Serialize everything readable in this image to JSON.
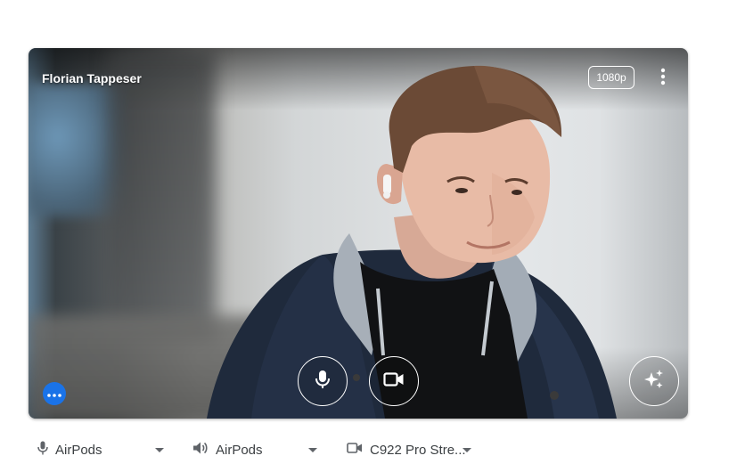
{
  "preview": {
    "participant_name": "Florian Tappeser",
    "resolution_badge": "1080p"
  },
  "controls": {
    "mic_icon": "mic-icon",
    "camera_icon": "videocam-icon",
    "effects_icon": "sparkles-icon",
    "more_icon": "more-vert-icon",
    "overflow_icon": "more-horiz-icon"
  },
  "devices": {
    "microphone": {
      "label": "AirPods",
      "icon": "mic-icon"
    },
    "speaker": {
      "label": "AirPods",
      "icon": "volume-icon"
    },
    "camera": {
      "label": "C922 Pro Stre...",
      "icon": "videocam-icon"
    }
  },
  "colors": {
    "accent": "#1a73e8",
    "text": "#3c4043",
    "icon": "#5f6368"
  }
}
